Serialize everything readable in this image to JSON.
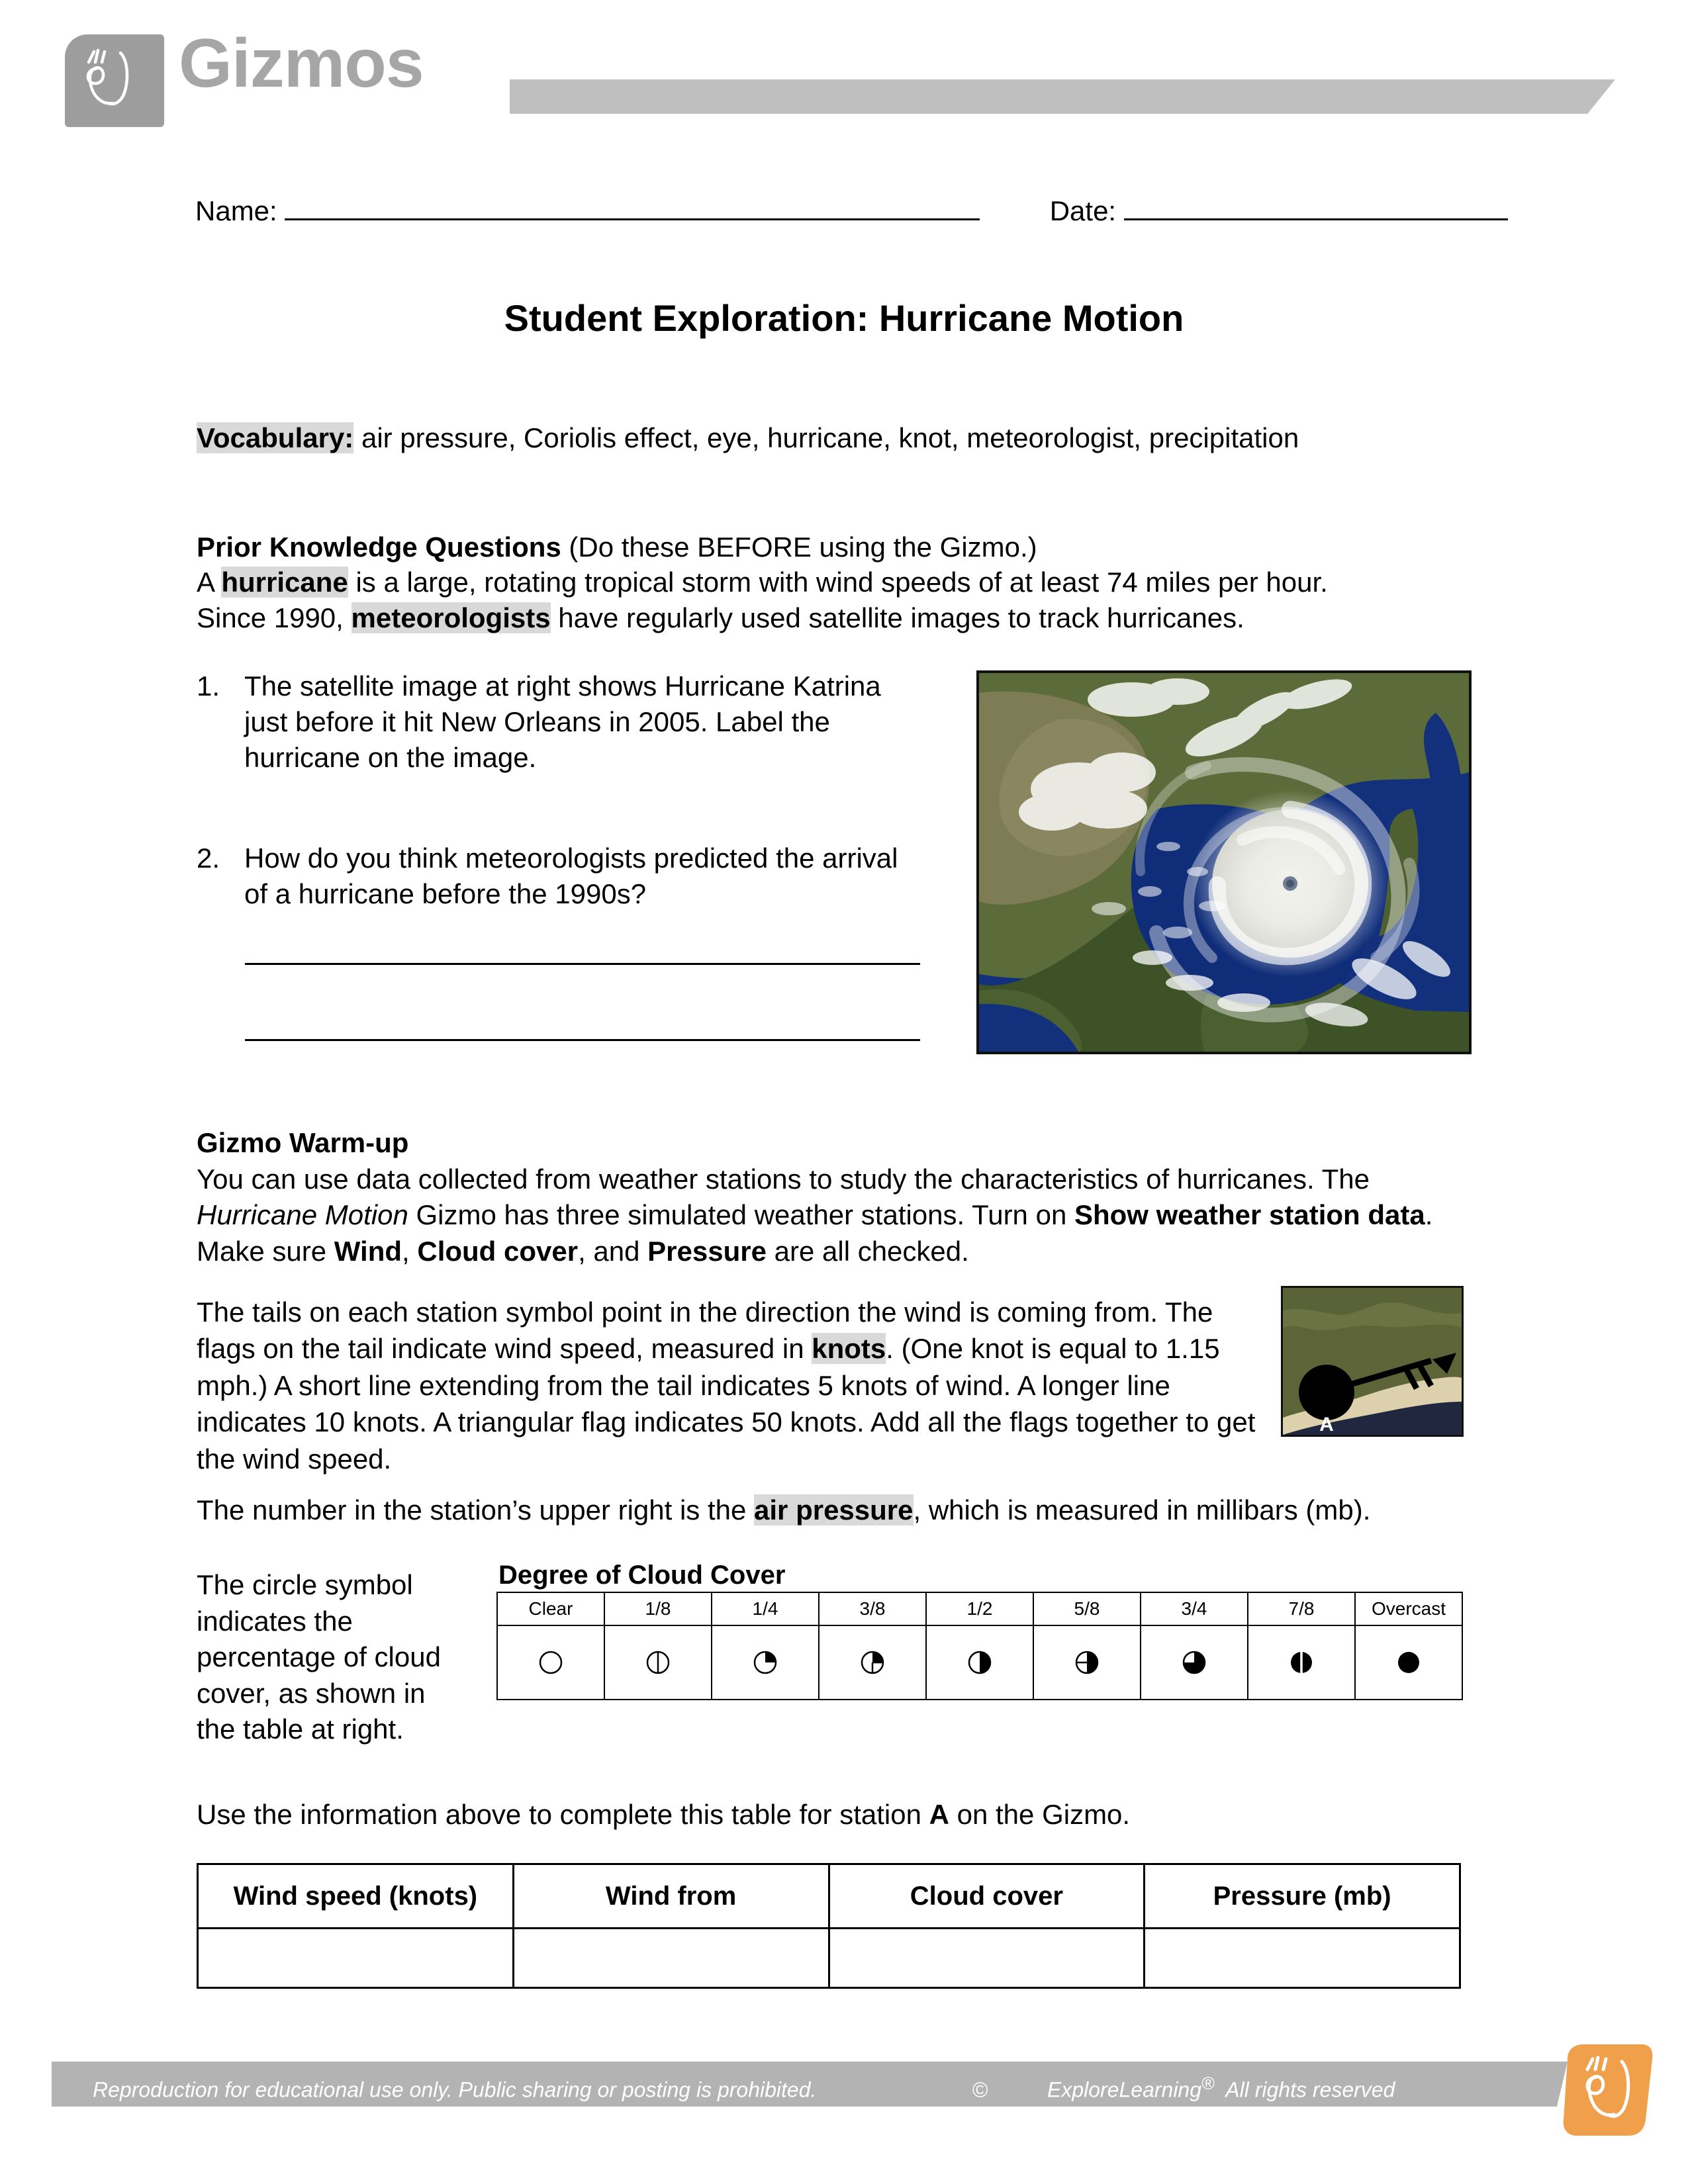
{
  "header": {
    "brand": "Gizmos",
    "logo_icon": "el-script-logo"
  },
  "form_fields": {
    "name_label": "Name:",
    "date_label": "Date:"
  },
  "title": "Student Exploration: Hurricane Motion",
  "vocabulary": {
    "label": "Vocabulary:",
    "terms": " air pressure, Coriolis effect, eye, hurricane, knot, meteorologist, precipitation"
  },
  "prior_knowledge": {
    "heading": "Prior Knowledge Questions",
    "heading_rest": " (Do these BEFORE using the Gizmo.)",
    "line2_a": "A ",
    "line2_term": "hurricane",
    "line2_b": " is a large, rotating tropical storm with wind speeds of at least 74 miles per hour.",
    "line3_a": "Since 1990, ",
    "line3_term": "meteorologists",
    "line3_b": " have regularly used satellite images to track hurricanes."
  },
  "questions": [
    {
      "number": "1.",
      "text": "The satellite image at right shows Hurricane Katrina just before it hit New Orleans in 2005. Label the hurricane on the image."
    },
    {
      "number": "2.",
      "text": "How do you think meteorologists predicted the arrival of a hurricane before the 1990s?"
    }
  ],
  "satellite_image": {
    "alt": "Satellite image of Hurricane Katrina over the Gulf of Mexico"
  },
  "warmup": {
    "heading": "Gizmo Warm-up",
    "p1_a": "You can use data collected from weather stations to study the characteristics of hurricanes. The ",
    "p1_italic": "Hurricane Motion",
    "p1_b": " Gizmo has three simulated weather stations. Turn on ",
    "p1_bold1": "Show weather station data",
    "p1_c": ". Make sure ",
    "p1_bold2": "Wind",
    "p1_d": ", ",
    "p1_bold3": "Cloud cover",
    "p1_e": ", and ",
    "p1_bold4": "Pressure",
    "p1_f": " are all checked."
  },
  "tails": {
    "a": "The tails on each station symbol point in the direction the wind is coming from. The flags on the tail indicate wind speed, measured in ",
    "term": "knots",
    "b": ". (One knot is equal to 1.15 mph.) A short line extending from the tail indicates 5 knots of wind. A longer line indicates 10 knots. A triangular flag indicates 50 knots. Add all the flags together to get the wind speed."
  },
  "station_symbol_image": {
    "station_label": "A"
  },
  "pressure_para": {
    "a": "The number in the station’s upper right is the ",
    "term": "air pressure",
    "b": ", which is measured in millibars (mb)."
  },
  "circle_para": "The circle symbol indicates the percentage of cloud cover, as shown in the table at right.",
  "cloud_cover": {
    "title": "Degree of Cloud Cover",
    "headers": [
      "Clear",
      "1/8",
      "1/4",
      "3/8",
      "1/2",
      "5/8",
      "3/4",
      "7/8",
      "Overcast"
    ],
    "symbols": [
      "clear",
      "one-eighth",
      "one-quarter",
      "three-eighths",
      "one-half",
      "five-eighths",
      "three-quarters",
      "seven-eighths",
      "overcast"
    ]
  },
  "use_info": {
    "a": "Use the information above to complete this table for station ",
    "station": "A",
    "b": " on the Gizmo."
  },
  "data_table": {
    "headers": [
      "Wind speed (knots)",
      "Wind from",
      "Cloud cover",
      "Pressure (mb)"
    ],
    "rows": [
      [
        "",
        "",
        "",
        ""
      ]
    ]
  },
  "footer": {
    "notice": "Reproduction for educational use only. Public sharing or posting is prohibited.",
    "copyright": "©",
    "company": "ExploreLearning",
    "registered": "®",
    "rights": "All rights reserved",
    "logo_icon": "el-script-logo"
  },
  "colors": {
    "logo_gray": "#9d9d9d",
    "brand_text_gray": "#a6a6a6",
    "header_bar_gray": "#bfbfbf",
    "footer_bar_gray": "#b3b3b3",
    "footer_logo_orange": "#f5a councilde"
  }
}
